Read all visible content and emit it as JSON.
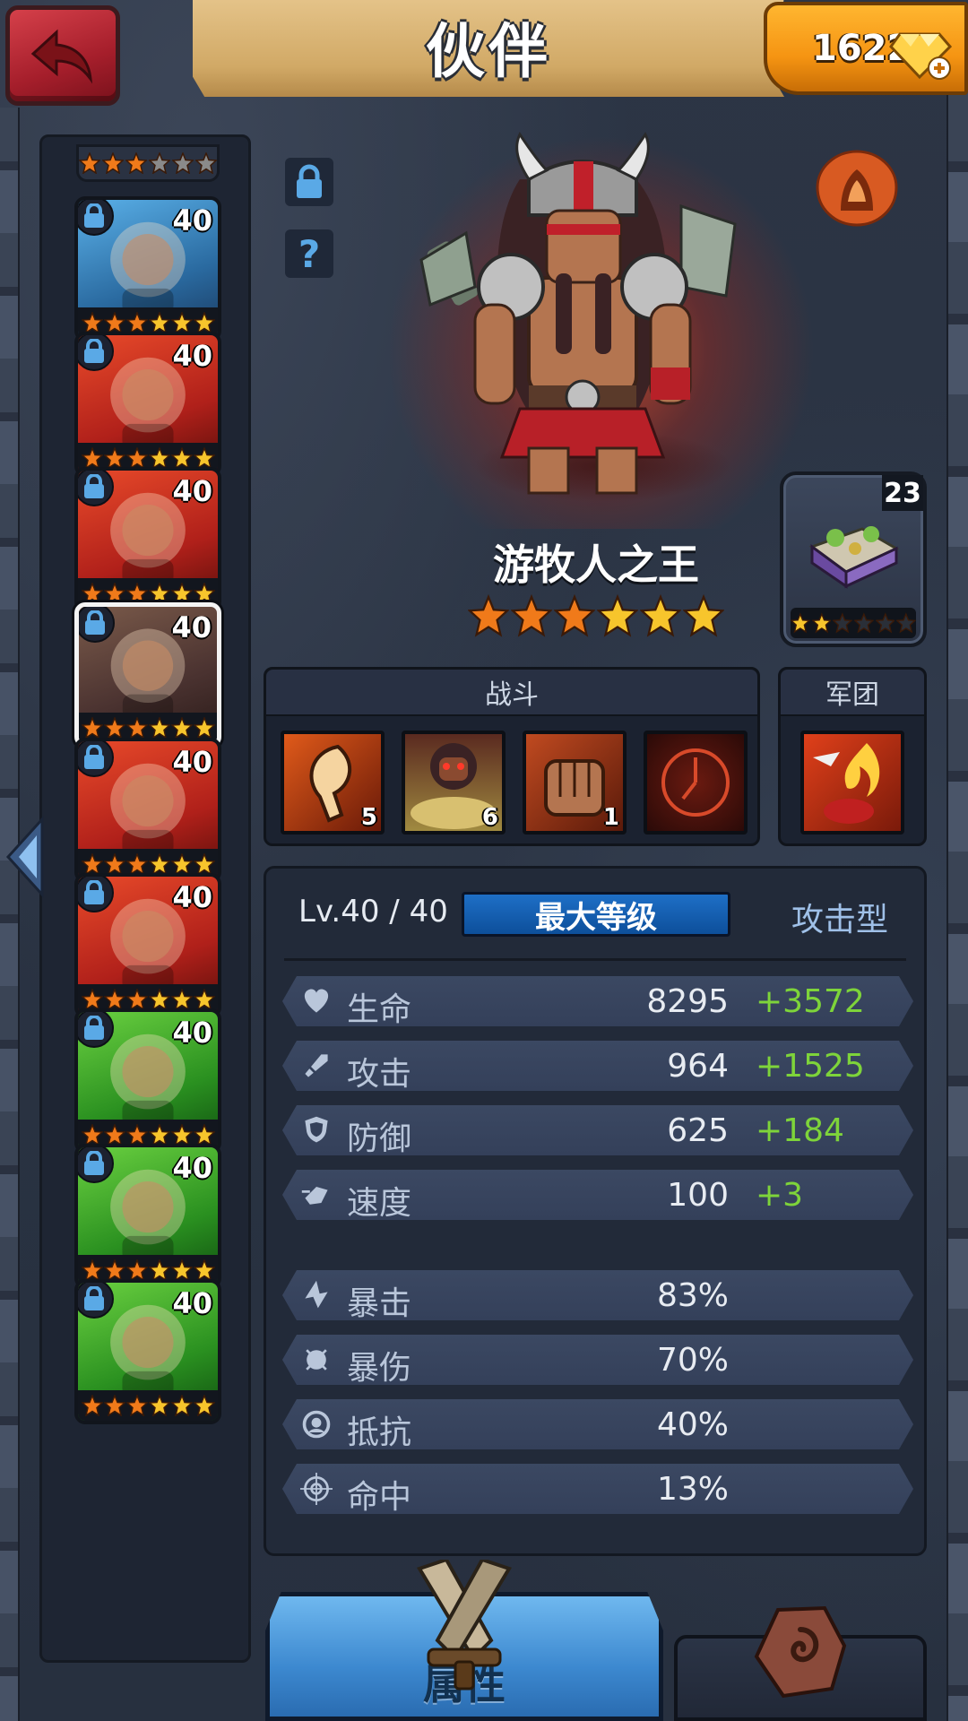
{
  "header": {
    "title": "伙伴",
    "gem_count": "16223"
  },
  "roster": {
    "top_partial_stars": 6,
    "heroes": [
      {
        "level": "40",
        "stars": 6,
        "palette": "blue"
      },
      {
        "level": "40",
        "stars": 6,
        "palette": "red"
      },
      {
        "level": "40",
        "stars": 6,
        "palette": "red"
      },
      {
        "level": "40",
        "stars": 6,
        "palette": "dark",
        "selected": true
      },
      {
        "level": "40",
        "stars": 6,
        "palette": "red"
      },
      {
        "level": "40",
        "stars": 6,
        "palette": "red"
      },
      {
        "level": "40",
        "stars": 6,
        "palette": "green"
      },
      {
        "level": "40",
        "stars": 6,
        "palette": "green"
      },
      {
        "level": "40",
        "stars": 6,
        "palette": "green"
      }
    ]
  },
  "hero": {
    "name": "游牧人之王",
    "stars_orange": 3,
    "stars_gold": 3
  },
  "equipment": {
    "count": "23",
    "stars_filled": 2,
    "stars_total": 6
  },
  "skills": {
    "header": "战斗",
    "items": [
      {
        "name": "axe-skill",
        "level": "5"
      },
      {
        "name": "rage-skill",
        "level": "6"
      },
      {
        "name": "fist-skill",
        "level": "1"
      },
      {
        "name": "locked-skill",
        "level": ""
      }
    ]
  },
  "legion": {
    "header": "军团"
  },
  "stats": {
    "level_text": "Lv.40 / 40",
    "max_level_label": "最大等级",
    "type_label": "攻击型",
    "primary": [
      {
        "name": "生命",
        "value": "8295",
        "bonus": "+3572",
        "icon": "heart-icon"
      },
      {
        "name": "攻击",
        "value": "964",
        "bonus": "+1525",
        "icon": "attack-icon"
      },
      {
        "name": "防御",
        "value": "625",
        "bonus": "+184",
        "icon": "shield-icon"
      },
      {
        "name": "速度",
        "value": "100",
        "bonus": "+3",
        "icon": "speed-icon"
      }
    ],
    "secondary": [
      {
        "name": "暴击",
        "value": "83%",
        "icon": "crit-icon"
      },
      {
        "name": "暴伤",
        "value": "70%",
        "icon": "crit-damage-icon"
      },
      {
        "name": "抵抗",
        "value": "40%",
        "icon": "resist-icon"
      },
      {
        "name": "命中",
        "value": "13%",
        "icon": "accuracy-icon"
      }
    ]
  },
  "tabs": {
    "attributes_label": "属性"
  },
  "colors": {
    "star_orange": "#f07a1a",
    "star_gold": "#f7c52c",
    "bonus_green": "#7ed43a",
    "max_level_blue": "#1e6fc6"
  }
}
